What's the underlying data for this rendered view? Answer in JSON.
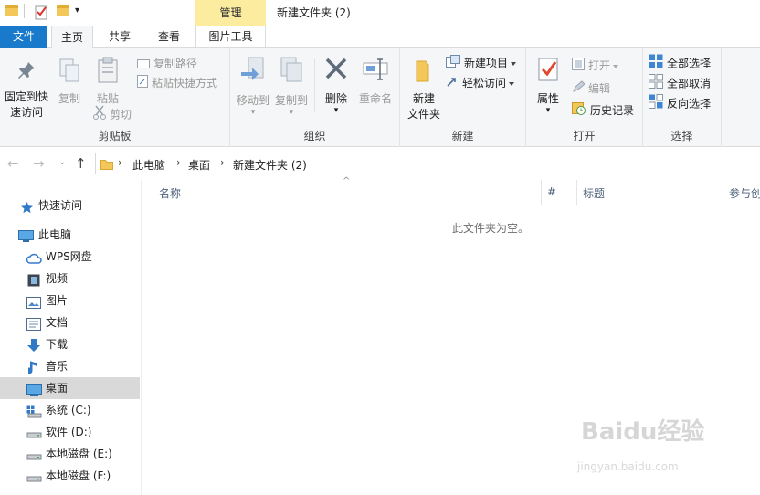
{
  "window": {
    "context_tab": "管理",
    "title": "新建文件夹 (2)"
  },
  "tabs": {
    "file": "文件",
    "home": "主页",
    "share": "共享",
    "view": "查看",
    "picture_tools": "图片工具"
  },
  "ribbon": {
    "clipboard": {
      "label": "剪贴板",
      "pin_line1": "固定到快",
      "pin_line2": "速访问",
      "copy": "复制",
      "paste": "粘贴",
      "copy_path": "复制路径",
      "paste_shortcut": "粘贴快捷方式",
      "cut": "剪切"
    },
    "organize": {
      "label": "组织",
      "move_to": "移动到",
      "copy_to": "复制到",
      "delete": "删除",
      "rename": "重命名"
    },
    "new": {
      "label": "新建",
      "new_folder_line1": "新建",
      "new_folder_line2": "文件夹",
      "new_item": "新建项目",
      "easy_access": "轻松访问"
    },
    "open": {
      "label": "打开",
      "properties": "属性",
      "open": "打开",
      "edit": "编辑",
      "history": "历史记录"
    },
    "select": {
      "label": "选择",
      "select_all": "全部选择",
      "select_none": "全部取消",
      "invert": "反向选择"
    }
  },
  "address": {
    "crumbs": [
      "此电脑",
      "桌面",
      "新建文件夹 (2)"
    ]
  },
  "nav": {
    "quick_access": "快速访问",
    "this_pc": "此电脑",
    "items": [
      "WPS网盘",
      "视频",
      "图片",
      "文档",
      "下载",
      "音乐",
      "桌面",
      "系统 (C:)",
      "软件 (D:)",
      "本地磁盘 (E:)",
      "本地磁盘 (F:)"
    ],
    "selected": "桌面"
  },
  "content": {
    "columns": [
      "名称",
      "#",
      "标题",
      "参与创"
    ],
    "empty_message": "此文件夹为空。"
  },
  "colors": {
    "accent": "#1979ca",
    "context_tab": "#fbeca0",
    "ribbon_bg": "#f5f6f7",
    "selected_row": "#d9d9d9"
  },
  "watermark": {
    "text": "Baidu经验",
    "url": "jingyan.baidu.com"
  }
}
